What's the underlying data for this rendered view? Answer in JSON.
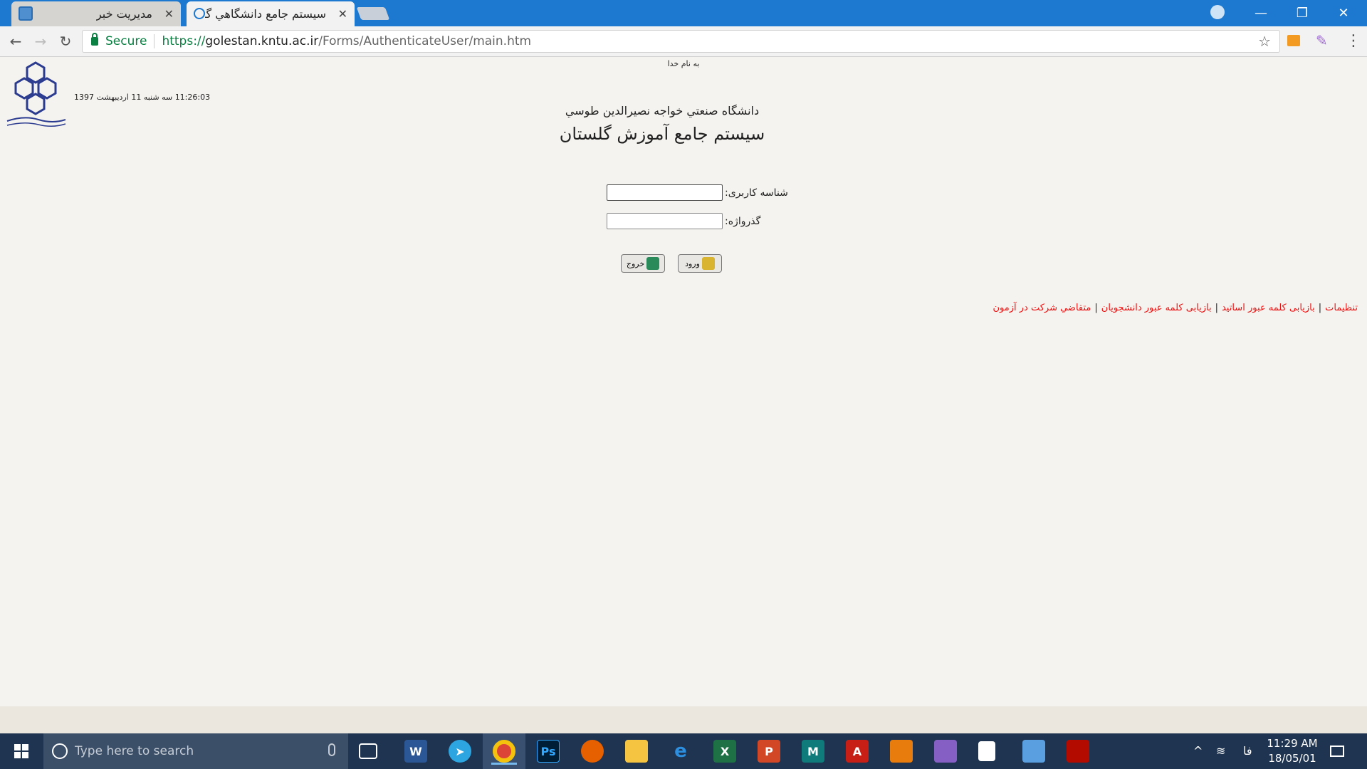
{
  "browser": {
    "tabs": [
      {
        "title": "مدیریت خبر",
        "active": false
      },
      {
        "title": "سیستم جامع دانشگاهي گلستان",
        "active": true
      }
    ],
    "address": {
      "secure_label": "Secure",
      "url_scheme": "https://",
      "url_host": "golestan.kntu.ac.ir",
      "url_path": "/Forms/AuthenticateUser/main.htm"
    }
  },
  "page": {
    "bismillah": "به نام خدا",
    "datetime": "11:26:03 سه شنبه 11 اردیبهشت 1397",
    "university_name": "دانشگاه صنعتي خواجه نصيرالدين طوسي",
    "system_name": "سيستم جامع آموزش گلستان",
    "username_label": "شناسه کاربری:",
    "username_value": "",
    "password_label": "گذرواژه:",
    "password_value": "",
    "login_button": "ورود",
    "exit_button": "خروج",
    "links": [
      "تنظیمات",
      "بازیابی کلمه عبور اساتيد",
      "بازیابی کلمه عبور دانشجويان",
      "متقاضي شرکت در آزمون"
    ]
  },
  "taskbar": {
    "search_placeholder": "Type here to search",
    "apps": [
      "task-view",
      "word",
      "telegram",
      "chrome",
      "photoshop",
      "firefox",
      "file-explorer",
      "edge",
      "excel",
      "powerpoint",
      "maya",
      "autocad",
      "blender",
      "visual-studio",
      "store",
      "remote-desktop",
      "acrobat"
    ],
    "active_app": "chrome",
    "language": "فا",
    "time": "11:29 AM",
    "date": "18/05/01"
  },
  "colors": {
    "titlebar": "#1c79cf",
    "link": "#ee1111",
    "taskbar": "#1f3450",
    "secure_green": "#0b8043"
  }
}
